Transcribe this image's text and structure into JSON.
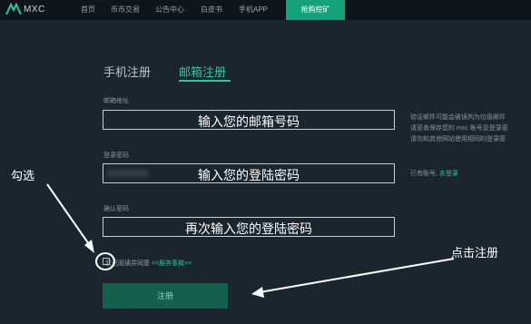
{
  "header": {
    "logo_text": "MXC",
    "nav": [
      "首页",
      "币币交易",
      "公告中心",
      "白皮书",
      "手机APP"
    ],
    "active_nav": "抢购挖矿"
  },
  "tabs": {
    "phone": "手机注册",
    "email": "邮箱注册"
  },
  "form": {
    "email_label": "邮箱地址",
    "email_overlay": "输入您的邮箱号码",
    "password_label": "登录密码",
    "password_overlay": "输入您的登陆密码",
    "confirm_label": "确认密码",
    "confirm_overlay": "再次输入您的登陆密码",
    "agree_text": "我已阅读并同意",
    "terms_link": "<<服务条款>>",
    "register_button": "注册"
  },
  "side": {
    "note_line1": "验证邮件可能会被误判为垃圾邮件",
    "note_line2": "请妥善保存您的 mxc 账号及登录密",
    "note_line3": "请勿和其他网站使用相同的登录密",
    "has_account": "已有账号,",
    "login_link": "去登录"
  },
  "annotations": {
    "check_label": "勾选",
    "click_register": "点击注册"
  },
  "colors": {
    "accent": "#2cc6a0",
    "active_nav_bg": "#13a37a",
    "button_bg": "#15604c"
  }
}
